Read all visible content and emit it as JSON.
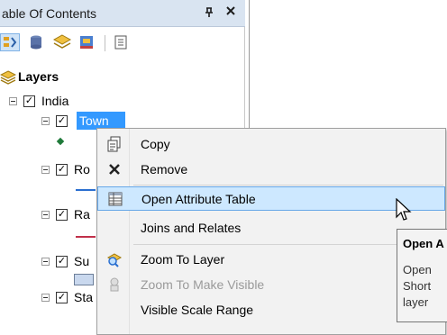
{
  "toc": {
    "title": "able Of Contents",
    "pin_glyph": "P",
    "close_glyph": "×",
    "layers_label": "Layers",
    "group_label": "India",
    "items": [
      {
        "label": "Town",
        "checked": true,
        "selected": true
      },
      {
        "label": "Ro",
        "checked": true
      },
      {
        "label": "Ra",
        "checked": true
      },
      {
        "label": "Su",
        "checked": true
      },
      {
        "label": "Sta",
        "checked": true
      }
    ],
    "check_glyph": "✓"
  },
  "context_menu": {
    "items": [
      {
        "label": "Copy",
        "icon": "copy-icon",
        "enabled": true
      },
      {
        "label": "Remove",
        "icon": "remove-icon",
        "enabled": true
      },
      {
        "label": "Open Attribute Table",
        "icon": "table-icon",
        "enabled": true,
        "highlighted": true
      },
      {
        "label": "Joins and Relates",
        "icon": "",
        "enabled": true
      },
      {
        "label": "Zoom To Layer",
        "icon": "zoom-to-layer-icon",
        "enabled": true
      },
      {
        "label": "Zoom To Make Visible",
        "icon": "zoom-visible-icon",
        "enabled": false
      },
      {
        "label": "Visible Scale Range",
        "icon": "",
        "enabled": true
      }
    ]
  },
  "tooltip": {
    "title": "Open A",
    "line1": "Open",
    "line2": "Short",
    "line3": "layer"
  },
  "colors": {
    "highlight": "#cde8ff",
    "selection": "#3399ff",
    "header": "#d9e4f1"
  }
}
